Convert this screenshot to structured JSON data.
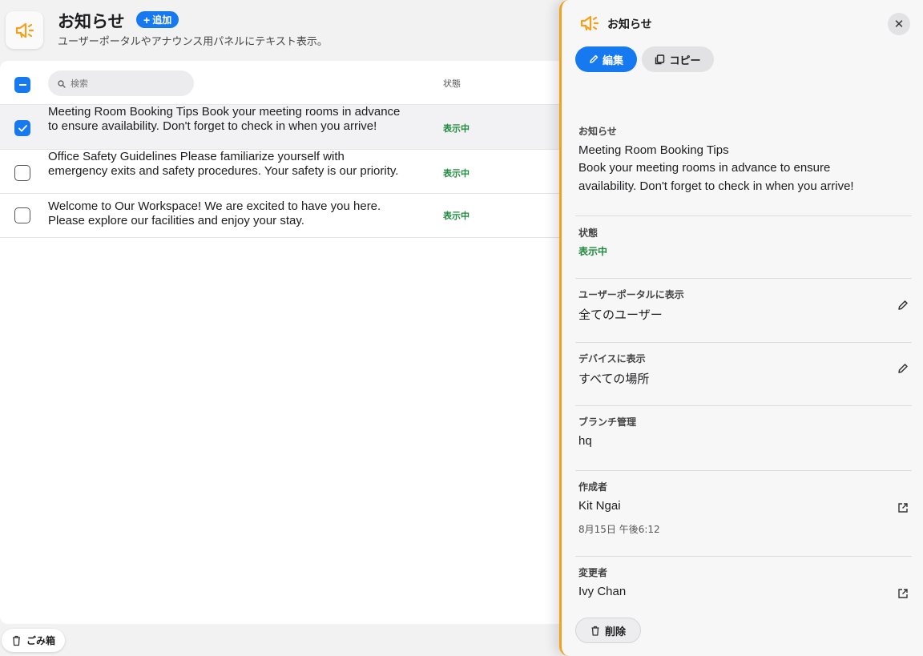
{
  "header": {
    "icon": "megaphone-icon",
    "title": "お知らせ",
    "add_label": "追加",
    "subtitle": "ユーザーポータルやアナウンス用パネルにテキスト表示。"
  },
  "list": {
    "search_placeholder": "検索",
    "status_header": "状態",
    "rows": [
      {
        "text": "Meeting Room Booking Tips Book your meeting rooms in advance to ensure availability. Don't forget to check in when you arrive!",
        "status": "表示中",
        "checked": true
      },
      {
        "text": "Office Safety Guidelines Please familiarize yourself with emergency exits and safety procedures. Your safety is our priority.",
        "status": "表示中",
        "checked": false
      },
      {
        "text": "Welcome to Our Workspace! We are excited to have you here. Please explore our facilities and enjoy your stay.",
        "status": "表示中",
        "checked": false
      }
    ]
  },
  "trash": {
    "label": "ごみ箱"
  },
  "detail": {
    "title": "お知らせ",
    "edit_label": "編集",
    "copy_label": "コピー",
    "announcement": {
      "label": "お知らせ",
      "heading": "Meeting Room Booking Tips",
      "body_line1": "Book your meeting rooms in advance to ensure",
      "body_line2": "availability. Don't forget to check in when you arrive!"
    },
    "status": {
      "label": "状態",
      "value": "表示中"
    },
    "portal": {
      "label": "ユーザーポータルに表示",
      "value": "全てのユーザー"
    },
    "device": {
      "label": "デバイスに表示",
      "value": "すべての場所"
    },
    "branch": {
      "label": "ブランチ管理",
      "value": "hq"
    },
    "creator": {
      "label": "作成者",
      "value": "Kit Ngai",
      "date": "8月15日 午後6:12"
    },
    "modifier": {
      "label": "変更者",
      "value": "Ivy Chan"
    },
    "delete_label": "削除"
  },
  "colors": {
    "accent": "#1779f0",
    "status_green": "#1e8a3c",
    "panel_border": "#f5a01a",
    "megaphone": "#f5a01a"
  }
}
